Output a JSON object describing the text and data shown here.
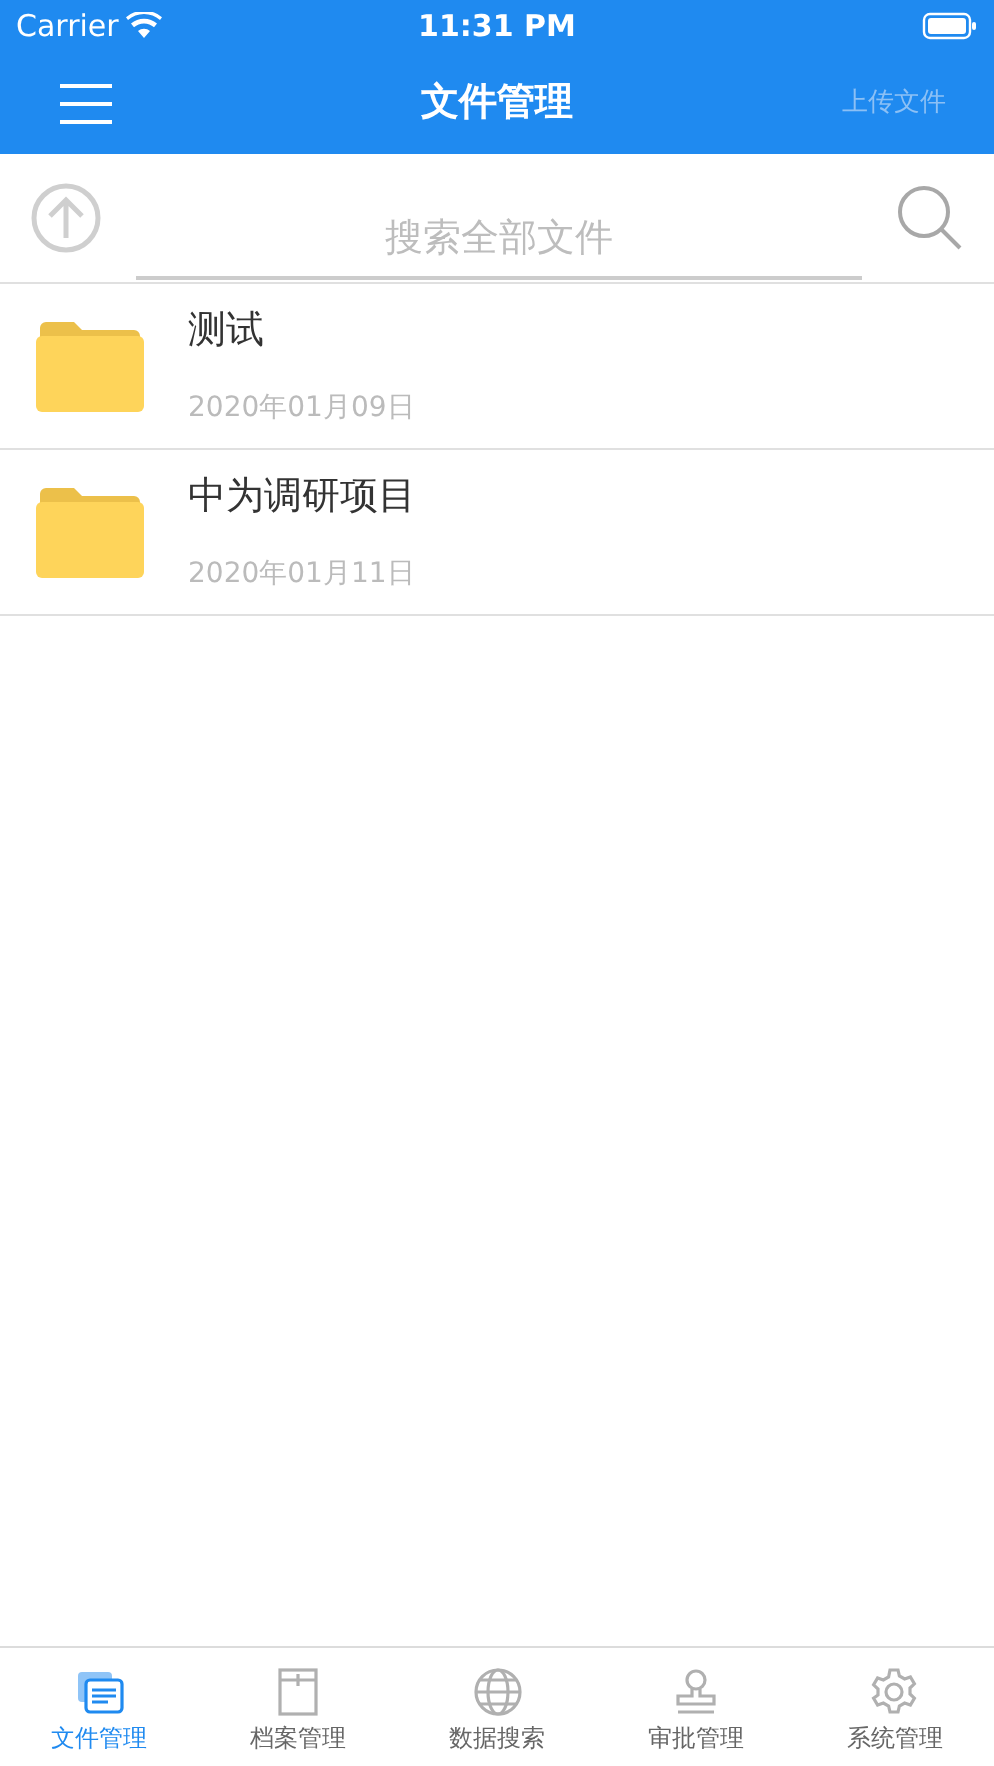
{
  "status_bar": {
    "carrier": "Carrier",
    "time": "11:31 PM"
  },
  "nav_bar": {
    "title": "文件管理",
    "action": "上传文件"
  },
  "search": {
    "placeholder": "搜索全部文件"
  },
  "files": [
    {
      "name": "测试",
      "date": "2020年01月09日"
    },
    {
      "name": "中为调研项目",
      "date": "2020年01月11日"
    }
  ],
  "tab_bar": [
    {
      "label": "文件管理",
      "selected": true
    },
    {
      "label": "档案管理",
      "selected": false
    },
    {
      "label": "数据搜索",
      "selected": false
    },
    {
      "label": "审批管理",
      "selected": false
    },
    {
      "label": "系统管理",
      "selected": false
    }
  ]
}
